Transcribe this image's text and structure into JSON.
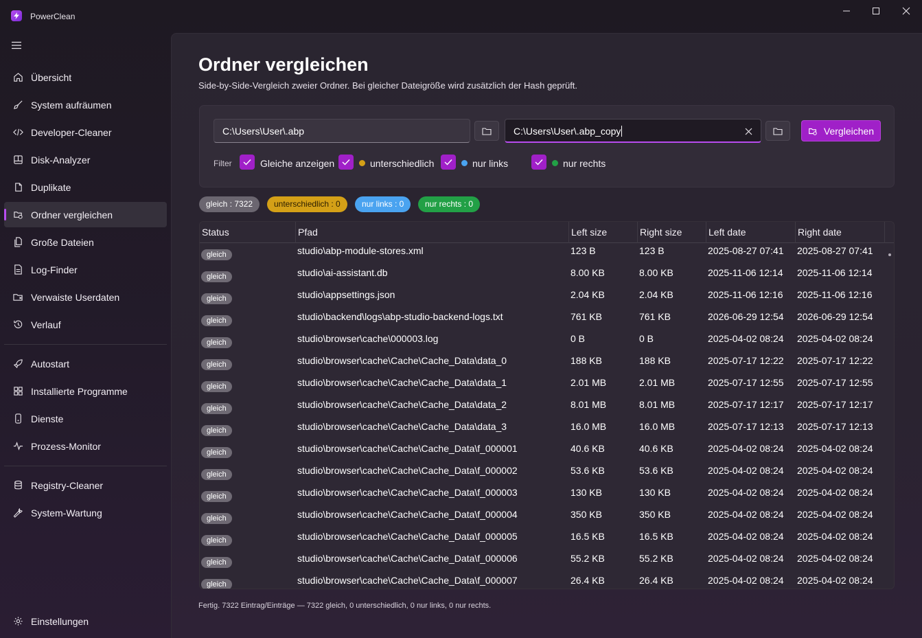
{
  "window": {
    "title": "PowerClean"
  },
  "sidebar": {
    "items": [
      {
        "label": "Übersicht",
        "icon": "home-icon"
      },
      {
        "label": "System aufräumen",
        "icon": "broom-icon"
      },
      {
        "label": "Developer-Cleaner",
        "icon": "code-icon"
      },
      {
        "label": "Disk-Analyzer",
        "icon": "disk-icon"
      },
      {
        "label": "Duplikate",
        "icon": "copy-icon"
      },
      {
        "label": "Ordner vergleichen",
        "icon": "compare-folder-icon",
        "active": true
      },
      {
        "label": "Große Dateien",
        "icon": "files-icon"
      },
      {
        "label": "Log-Finder",
        "icon": "document-icon"
      },
      {
        "label": "Verwaiste Userdaten",
        "icon": "folder-orphan-icon"
      },
      {
        "label": "Verlauf",
        "icon": "history-icon"
      },
      {
        "label": "Autostart",
        "icon": "rocket-icon"
      },
      {
        "label": "Installierte Programme",
        "icon": "grid-icon"
      },
      {
        "label": "Dienste",
        "icon": "service-icon"
      },
      {
        "label": "Prozess-Monitor",
        "icon": "pulse-icon"
      },
      {
        "label": "Registry-Cleaner",
        "icon": "database-icon"
      },
      {
        "label": "System-Wartung",
        "icon": "wrench-icon"
      }
    ],
    "settings_label": "Einstellungen"
  },
  "page": {
    "title": "Ordner vergleichen",
    "subtitle": "Side-by-Side-Vergleich zweier Ordner. Bei gleicher Dateigröße wird zusätzlich der Hash geprüft."
  },
  "form": {
    "left_path": "C:\\Users\\User\\.abp",
    "right_path": "C:\\Users\\User\\.abp_copy",
    "compare_label": "Vergleichen",
    "filter_label": "Filter",
    "filters": [
      {
        "label": "Gleiche anzeigen",
        "checked": true,
        "dot_color": ""
      },
      {
        "label": "unterschiedlich",
        "checked": true,
        "dot_color": "#d4a017"
      },
      {
        "label": "nur links",
        "checked": true,
        "dot_color": "#4aa3f0"
      },
      {
        "label": "nur rechts",
        "checked": true,
        "dot_color": "#22a046"
      }
    ]
  },
  "summary": {
    "gleich": "gleich : 7322",
    "unterschiedlich": "unterschiedlich : 0",
    "nur_links": "nur links : 0",
    "nur_rechts": "nur rechts : 0"
  },
  "table": {
    "columns": [
      "Status",
      "Pfad",
      "Left size",
      "Right size",
      "Left date",
      "Right date"
    ],
    "rows": [
      [
        "gleich",
        "studio\\abp-module-stores.xml",
        "123 B",
        "123 B",
        "2025-08-27 07:41",
        "2025-08-27 07:41"
      ],
      [
        "gleich",
        "studio\\ai-assistant.db",
        "8.00 KB",
        "8.00 KB",
        "2025-11-06 12:14",
        "2025-11-06 12:14"
      ],
      [
        "gleich",
        "studio\\appsettings.json",
        "2.04 KB",
        "2.04 KB",
        "2025-11-06 12:16",
        "2025-11-06 12:16"
      ],
      [
        "gleich",
        "studio\\backend\\logs\\abp-studio-backend-logs.txt",
        "761 KB",
        "761 KB",
        "2026-06-29 12:54",
        "2026-06-29 12:54"
      ],
      [
        "gleich",
        "studio\\browser\\cache\\000003.log",
        "0 B",
        "0 B",
        "2025-04-02 08:24",
        "2025-04-02 08:24"
      ],
      [
        "gleich",
        "studio\\browser\\cache\\Cache\\Cache_Data\\data_0",
        "188 KB",
        "188 KB",
        "2025-07-17 12:22",
        "2025-07-17 12:22"
      ],
      [
        "gleich",
        "studio\\browser\\cache\\Cache\\Cache_Data\\data_1",
        "2.01 MB",
        "2.01 MB",
        "2025-07-17 12:55",
        "2025-07-17 12:55"
      ],
      [
        "gleich",
        "studio\\browser\\cache\\Cache\\Cache_Data\\data_2",
        "8.01 MB",
        "8.01 MB",
        "2025-07-17 12:17",
        "2025-07-17 12:17"
      ],
      [
        "gleich",
        "studio\\browser\\cache\\Cache\\Cache_Data\\data_3",
        "16.0 MB",
        "16.0 MB",
        "2025-07-17 12:13",
        "2025-07-17 12:13"
      ],
      [
        "gleich",
        "studio\\browser\\cache\\Cache\\Cache_Data\\f_000001",
        "40.6 KB",
        "40.6 KB",
        "2025-04-02 08:24",
        "2025-04-02 08:24"
      ],
      [
        "gleich",
        "studio\\browser\\cache\\Cache\\Cache_Data\\f_000002",
        "53.6 KB",
        "53.6 KB",
        "2025-04-02 08:24",
        "2025-04-02 08:24"
      ],
      [
        "gleich",
        "studio\\browser\\cache\\Cache\\Cache_Data\\f_000003",
        "130 KB",
        "130 KB",
        "2025-04-02 08:24",
        "2025-04-02 08:24"
      ],
      [
        "gleich",
        "studio\\browser\\cache\\Cache\\Cache_Data\\f_000004",
        "350 KB",
        "350 KB",
        "2025-04-02 08:24",
        "2025-04-02 08:24"
      ],
      [
        "gleich",
        "studio\\browser\\cache\\Cache\\Cache_Data\\f_000005",
        "16.5 KB",
        "16.5 KB",
        "2025-04-02 08:24",
        "2025-04-02 08:24"
      ],
      [
        "gleich",
        "studio\\browser\\cache\\Cache\\Cache_Data\\f_000006",
        "55.2 KB",
        "55.2 KB",
        "2025-04-02 08:24",
        "2025-04-02 08:24"
      ],
      [
        "gleich",
        "studio\\browser\\cache\\Cache\\Cache_Data\\f_000007",
        "26.4 KB",
        "26.4 KB",
        "2025-04-02 08:24",
        "2025-04-02 08:24"
      ]
    ]
  },
  "status_bar": "Fertig. 7322 Eintrag/Einträge — 7322 gleich, 0 unterschiedlich, 0 nur links, 0 nur rechts.",
  "colors": {
    "accent": "#a020c8",
    "gleich": "#6b6670",
    "unterschiedlich": "#d4a017",
    "nur_links": "#4aa3f0",
    "nur_rechts": "#22a046"
  }
}
